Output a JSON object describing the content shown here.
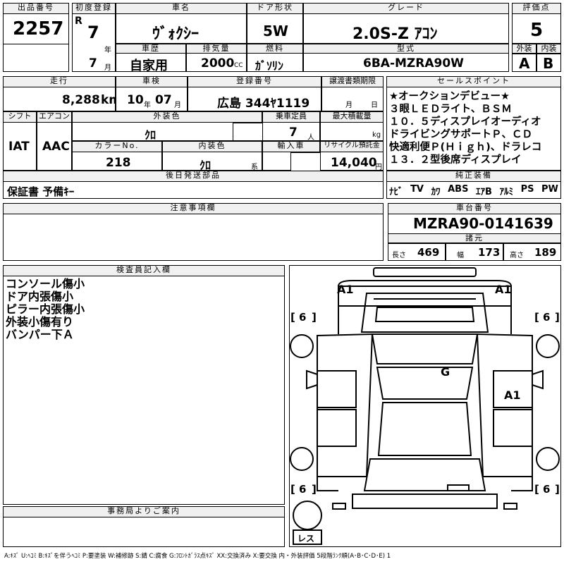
{
  "lot": {
    "label": "出品番号",
    "value": "2257"
  },
  "first_reg": {
    "label": "初度登録",
    "era": "R",
    "year": "7",
    "year_unit": "年",
    "month": "7",
    "month_unit": "月"
  },
  "car_name": {
    "label": "車名",
    "value": "ｳﾞｫｸｼｰ"
  },
  "history": {
    "label": "車歴",
    "value": "自家用"
  },
  "displacement": {
    "label": "排気量",
    "value": "2000",
    "unit": "CC"
  },
  "doors": {
    "label": "ドア形状",
    "value": "5W"
  },
  "fuel": {
    "label": "燃料",
    "value": "ｶﾞｿﾘﾝ"
  },
  "grade": {
    "label": "グレード",
    "value": "2.0S-Z ｱｺﾝ"
  },
  "model": {
    "label": "型式",
    "value": "6BA-MZRA90W"
  },
  "score": {
    "label": "評価点",
    "value": "5",
    "ext_label": "外装",
    "int_label": "内装",
    "ext": "A",
    "int": "B"
  },
  "mileage": {
    "label": "走行",
    "value": "8,288",
    "unit": "km"
  },
  "inspection": {
    "label": "車検",
    "year": "10",
    "year_unit": "年",
    "month": "07",
    "month_unit": "月"
  },
  "plate": {
    "label": "登録番号",
    "value": "広島 344ﾔ1119"
  },
  "transfer": {
    "label": "譲渡書類期限",
    "month_unit": "月",
    "day_unit": "日"
  },
  "shift": {
    "label": "シフト",
    "value": "IAT"
  },
  "aircon": {
    "label": "エアコン",
    "value": "AAC"
  },
  "ext_color": {
    "label": "外装色",
    "value": "ｸﾛ"
  },
  "seats": {
    "label": "乗車定員",
    "value": "7",
    "unit": "人"
  },
  "max_load": {
    "label": "最大積載量",
    "unit": "kg"
  },
  "color_no": {
    "label": "カラーNo.",
    "value": "218"
  },
  "int_color": {
    "label": "内装色",
    "value": "ｸﾛ",
    "unit": "系"
  },
  "import": {
    "label": "輸入車"
  },
  "recycle": {
    "label": "リサイクル預託金",
    "value": "14,040",
    "unit": "円"
  },
  "later": {
    "label": "後日発送部品",
    "value": "保証書 予備ｷｰ"
  },
  "sales_points": {
    "label": "セールスポイント",
    "lines": [
      "★オークションデビュー★",
      "３眼ＬＥＤライト、ＢＳＭ",
      "１０．５ディスプレイオーディオ",
      "ドライビングサポートＰ、ＣＤ",
      "快適利便Ｐ(Ｈｉｇｈ)、ドラレコ",
      "１３．２型後席ディスプレイ"
    ]
  },
  "equipment": {
    "label": "純正装備",
    "items": [
      "ﾅﾋﾞ",
      "TV",
      "ｶﾜ",
      "ABS",
      "ｴｱB",
      "ｱﾙﾐ",
      "PS",
      "PW"
    ]
  },
  "caution": {
    "label": "注意事項欄"
  },
  "chassis": {
    "label": "車台番号",
    "value": "MZRA90-0141639"
  },
  "specs": {
    "label": "諸元",
    "length_label": "長さ",
    "length": "469",
    "width_label": "幅",
    "width": "173",
    "height_label": "高さ",
    "height": "189"
  },
  "inspector": {
    "label": "検査員記入欄",
    "notes": [
      "コンソール傷小",
      "ドア内張傷小",
      "ピラー内張傷小",
      "外装小傷有り",
      "バンパー下Ａ"
    ]
  },
  "office": {
    "label": "事務局よりご案内"
  },
  "diagram": {
    "marks": {
      "front_left": "A1",
      "front_right": "A1",
      "roof": "G",
      "right_side": "A1"
    },
    "tires": "6",
    "spare": "レス",
    "bracket_open": "[",
    "bracket_close": "]"
  },
  "legend": "A:ｷｽﾞ U:ﾍｺﾐ B:ｷｽﾞを伴うﾍｺﾐ P:要塗装 W:補修跡 S:錆 C:腐食 G:ﾌﾛﾝﾄｶﾞﾗｽ点ｷｽﾞ XX:交換済み X:要交換 内・外装評価 5段階ﾗﾝｸ順(A･B･C･D･E) 1"
}
